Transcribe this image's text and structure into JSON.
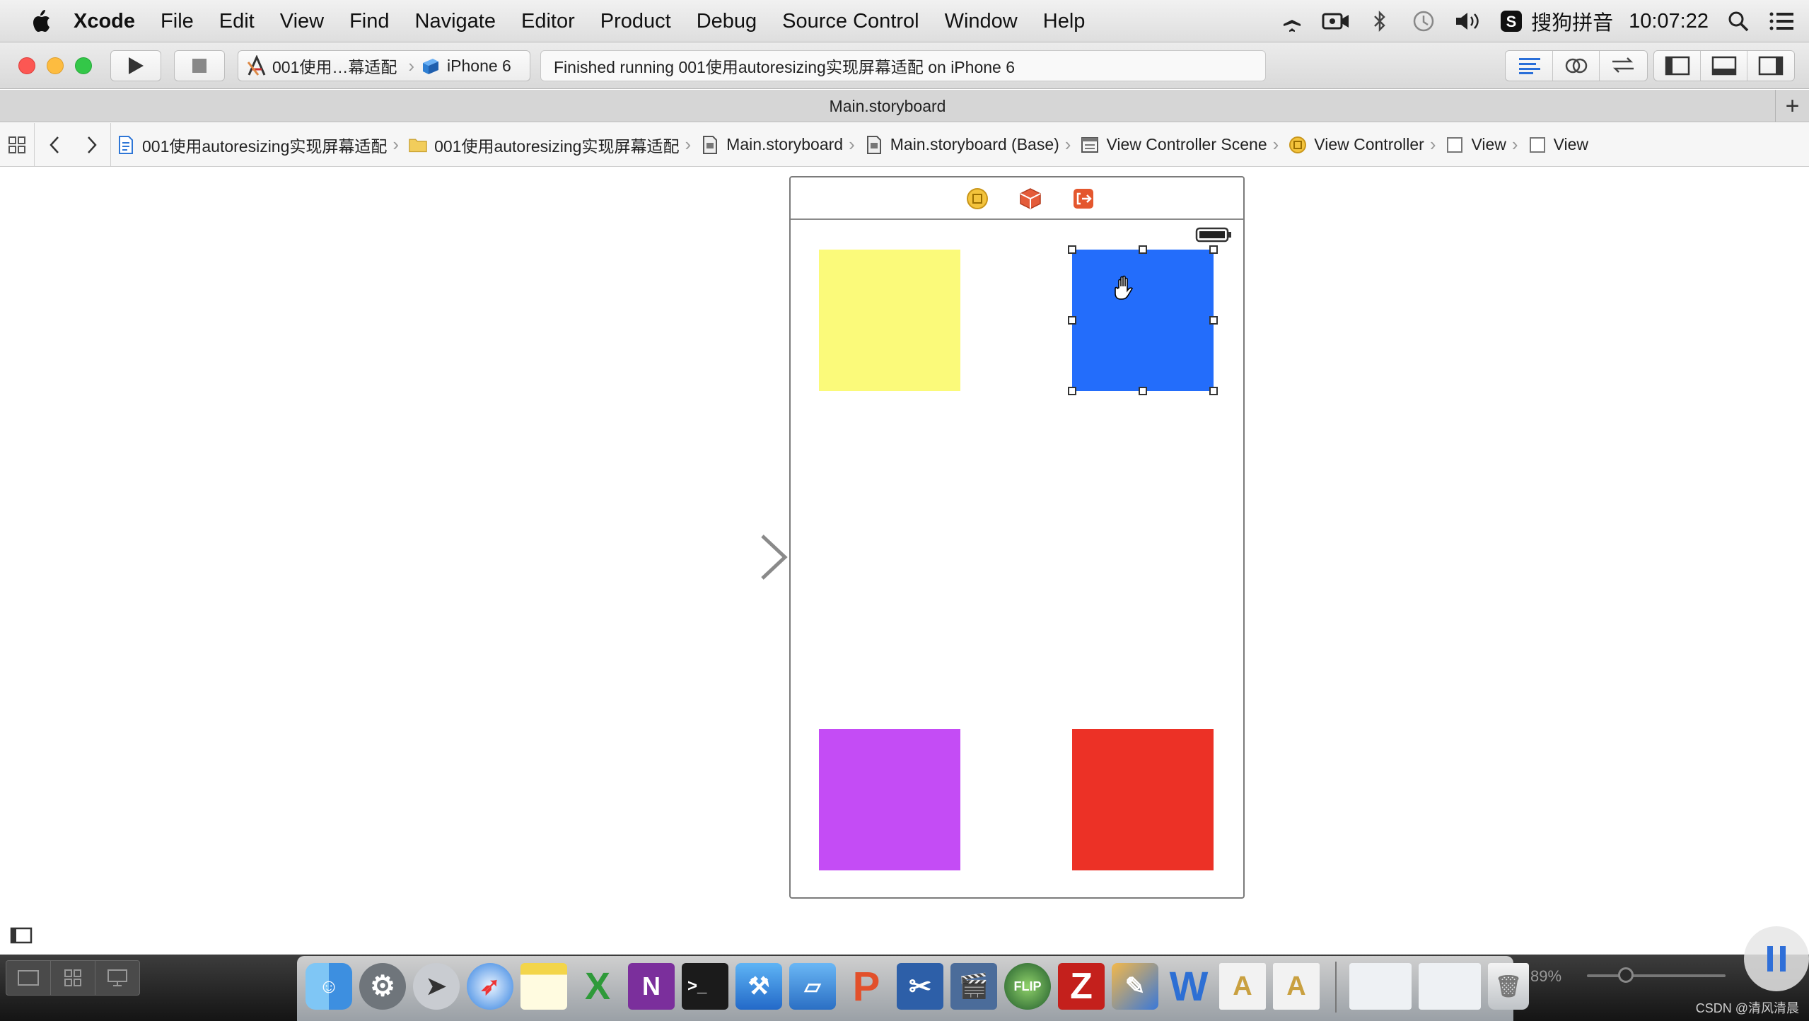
{
  "menubar": {
    "app_name": "Xcode",
    "items": [
      "File",
      "Edit",
      "View",
      "Find",
      "Navigate",
      "Editor",
      "Product",
      "Debug",
      "Source Control",
      "Window",
      "Help"
    ],
    "input_method": "搜狗拼音",
    "clock": "10:07:22"
  },
  "toolbar": {
    "scheme": "001使用…幕适配",
    "device": "iPhone 6",
    "status": "Finished running 001使用autoresizing实现屏幕适配 on iPhone 6"
  },
  "tab": {
    "title": "Main.storyboard",
    "add": "+"
  },
  "jumpbar": {
    "crumbs": [
      "001使用autoresizing实现屏幕适配",
      "001使用autoresizing实现屏幕适配",
      "Main.storyboard",
      "Main.storyboard (Base)",
      "View Controller Scene",
      "View Controller",
      "View",
      "View"
    ]
  },
  "canvas": {
    "squares": [
      {
        "name": "yellow-view",
        "color": "#fbfa7a"
      },
      {
        "name": "blue-view",
        "color": "#236dfb",
        "selected": true
      },
      {
        "name": "purple-view",
        "color": "#c44cf5"
      },
      {
        "name": "red-view",
        "color": "#ec3126"
      }
    ]
  },
  "bottom": {
    "zoom": "89%",
    "watermark": "CSDN @清风清晨"
  },
  "colors": {
    "close": "#fc5753",
    "minimize": "#fdbc40",
    "zoom": "#33c748",
    "accent": "#236dfb"
  }
}
